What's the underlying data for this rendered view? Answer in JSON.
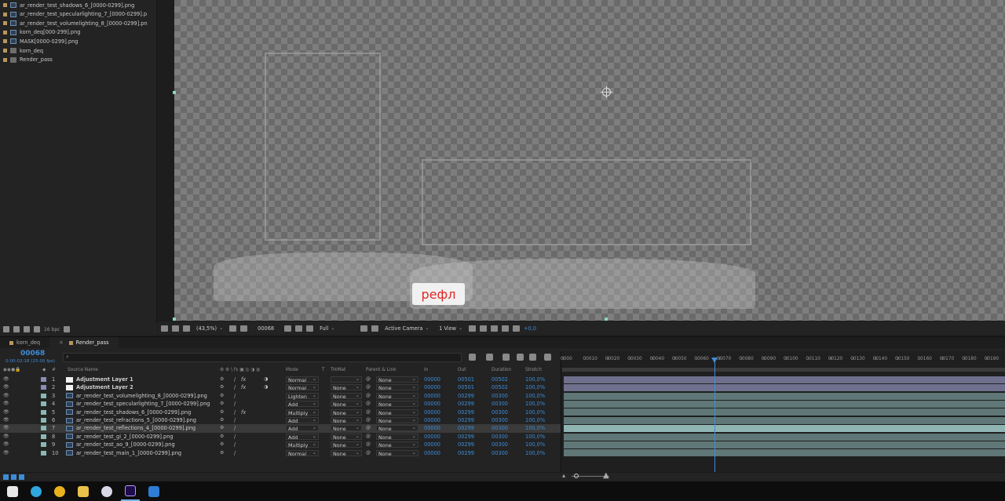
{
  "project": {
    "items": [
      {
        "name": "ar_render_test_shadows_6_[0000-0299].png",
        "type": "footage",
        "color": "#b9965b"
      },
      {
        "name": "ar_render_test_specularlighting_7_[0000-0299].p",
        "type": "footage",
        "color": "#b9965b"
      },
      {
        "name": "ar_render_test_volumelighting_8_[0000-0299].pn",
        "type": "footage",
        "color": "#b9965b"
      },
      {
        "name": "korn_deq[000-299].png",
        "type": "footage",
        "color": "#b9965b"
      },
      {
        "name": "MASK[0000-0299].png",
        "type": "footage",
        "color": "#b9965b"
      },
      {
        "name": "korn_deq",
        "type": "comp",
        "color": "#b9965b"
      },
      {
        "name": "Render_pass",
        "type": "comp",
        "color": "#b9965b"
      }
    ],
    "bpc": "16 bpc"
  },
  "viewer": {
    "caption": "рефл",
    "toolbar": {
      "zoom": "(43,5%)",
      "frame": "00068",
      "resolution": "Full",
      "camera": "Active Camera",
      "views": "1 View",
      "exposure": "+0,0"
    }
  },
  "tabs": [
    {
      "label": "korn_deq",
      "active": false
    },
    {
      "label": "Render_pass",
      "active": true
    }
  ],
  "timeline": {
    "timecode": "00068",
    "fps": "0:00:02:18 (25.00 fps)",
    "columns": {
      "source": "Source Name",
      "mode": "Mode",
      "t": "T",
      "trkmat": "TrkMat",
      "parent": "Parent & Link",
      "in": "In",
      "out": "Out",
      "duration": "Duration",
      "stretch": "Stretch"
    },
    "ruler": [
      "0000",
      "00010",
      "00020",
      "00030",
      "00040",
      "00050",
      "00060",
      "00070",
      "00080",
      "00090",
      "00100",
      "00110",
      "00120",
      "00130",
      "00140",
      "00150",
      "00160",
      "00170",
      "00180",
      "00190"
    ],
    "layers": [
      {
        "num": "1",
        "name": "Adjustment Layer 1",
        "kind": "solid",
        "mode": "Normal",
        "trkmat": "",
        "parent": "None",
        "in": "00000",
        "out": "00501",
        "dur": "00502",
        "stretch": "100,0%",
        "fx": "fx",
        "selected": false
      },
      {
        "num": "2",
        "name": "Adjustment Layer 2",
        "kind": "solid",
        "mode": "Normal",
        "trkmat": "None",
        "parent": "None",
        "in": "00000",
        "out": "00501",
        "dur": "00502",
        "stretch": "100,0%",
        "fx": "fx",
        "selected": false
      },
      {
        "num": "3",
        "name": "ar_render_test_volumelighting_8_[0000-0299].png",
        "kind": "foot",
        "mode": "Lighten",
        "trkmat": "None",
        "parent": "None",
        "in": "00000",
        "out": "00299",
        "dur": "00300",
        "stretch": "100,0%",
        "fx": "",
        "selected": false
      },
      {
        "num": "4",
        "name": "ar_render_test_specularlighting_7_[0000-0299].png",
        "kind": "foot",
        "mode": "Add",
        "trkmat": "None",
        "parent": "None",
        "in": "00000",
        "out": "00299",
        "dur": "00300",
        "stretch": "100,0%",
        "fx": "",
        "selected": false
      },
      {
        "num": "5",
        "name": "ar_render_test_shadows_6_[0000-0299].png",
        "kind": "foot",
        "mode": "Multiply",
        "trkmat": "None",
        "parent": "None",
        "in": "00000",
        "out": "00299",
        "dur": "00300",
        "stretch": "100,0%",
        "fx": "fx",
        "selected": false
      },
      {
        "num": "6",
        "name": "ar_render_test_refractions_5_[0000-0299].png",
        "kind": "foot",
        "mode": "Add",
        "trkmat": "None",
        "parent": "None",
        "in": "00000",
        "out": "00299",
        "dur": "00300",
        "stretch": "100,0%",
        "fx": "",
        "selected": false
      },
      {
        "num": "7",
        "name": "ar_render_test_reflections_4_[0000-0299].png",
        "kind": "foot",
        "mode": "Add",
        "trkmat": "None",
        "parent": "None",
        "in": "00000",
        "out": "00299",
        "dur": "00300",
        "stretch": "100,0%",
        "fx": "",
        "selected": true
      },
      {
        "num": "8",
        "name": "ar_render_test_gi_2_[0000-0299].png",
        "kind": "foot",
        "mode": "Add",
        "trkmat": "None",
        "parent": "None",
        "in": "00000",
        "out": "00299",
        "dur": "00300",
        "stretch": "100,0%",
        "fx": "",
        "selected": false
      },
      {
        "num": "9",
        "name": "ar_render_test_ao_9_[0000-0299].png",
        "kind": "foot",
        "mode": "Multiply",
        "trkmat": "None",
        "parent": "None",
        "in": "00000",
        "out": "00299",
        "dur": "00300",
        "stretch": "100,0%",
        "fx": "",
        "selected": false
      },
      {
        "num": "10",
        "name": "ar_render_test_main_1_[0000-0299].png",
        "kind": "foot",
        "mode": "Normal",
        "trkmat": "None",
        "parent": "None",
        "in": "00000",
        "out": "00299",
        "dur": "00300",
        "stretch": "100,0%",
        "fx": "",
        "selected": false
      }
    ]
  },
  "taskbar": {
    "apps": [
      {
        "name": "start-icon",
        "color": "#e8e8e8"
      },
      {
        "name": "telegram-icon",
        "color": "#2ea6de"
      },
      {
        "name": "chrome-icon",
        "color": "#e8b21d"
      },
      {
        "name": "explorer-icon",
        "color": "#e8c14a"
      },
      {
        "name": "obs-icon",
        "color": "#d8d8e8"
      },
      {
        "name": "after-effects-icon",
        "color": "#1f0c4c"
      },
      {
        "name": "onedrive-icon",
        "color": "#2e7cd6"
      }
    ]
  }
}
